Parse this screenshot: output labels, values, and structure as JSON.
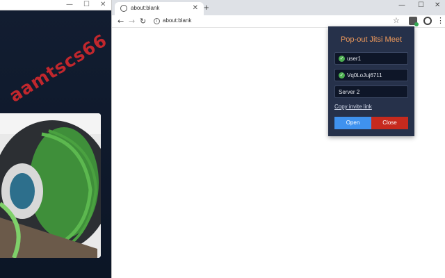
{
  "background_window": {
    "controls": {
      "minimize": "—",
      "maximize": "☐",
      "close": "✕"
    },
    "watermark": "aamtscs66"
  },
  "browser": {
    "tab": {
      "title": "about:blank",
      "close": "✕",
      "favicon": "globe-icon"
    },
    "new_tab": "+",
    "window_controls": {
      "minimize": "—",
      "maximize": "☐",
      "close": "✕"
    },
    "nav": {
      "back": "←",
      "forward": "→",
      "reload": "↻"
    },
    "address_bar": {
      "url": "about:blank",
      "info_icon": "i"
    },
    "toolbar_icons": {
      "star": "☆",
      "menu": "⋮"
    }
  },
  "popup": {
    "title": "Pop-out Jitsi Meet",
    "fields": [
      {
        "value": "user1",
        "verified": true
      },
      {
        "value": "Vq0LoJuj6711",
        "verified": true
      },
      {
        "value": "Server 2",
        "verified": false
      }
    ],
    "copy_link": "Copy invite link",
    "open_label": "Open",
    "close_label": "Close",
    "colors": {
      "accent_title": "#f29b5b",
      "open": "#3f92ef",
      "close": "#c62a1e",
      "bg": "#26314a"
    }
  }
}
